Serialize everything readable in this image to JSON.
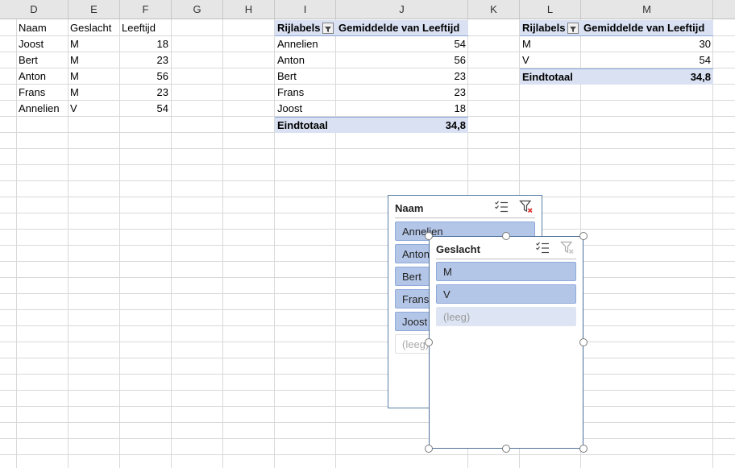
{
  "columns": [
    "D",
    "E",
    "F",
    "G",
    "H",
    "I",
    "J",
    "K",
    "L",
    "M"
  ],
  "source_table": {
    "headers": [
      "Naam",
      "Geslacht",
      "Leeftijd"
    ],
    "rows": [
      {
        "naam": "Joost",
        "geslacht": "M",
        "leeftijd": "18"
      },
      {
        "naam": "Bert",
        "geslacht": "M",
        "leeftijd": "23"
      },
      {
        "naam": "Anton",
        "geslacht": "M",
        "leeftijd": "56"
      },
      {
        "naam": "Frans",
        "geslacht": "M",
        "leeftijd": "23"
      },
      {
        "naam": "Annelien",
        "geslacht": "V",
        "leeftijd": "54"
      }
    ]
  },
  "pivot1": {
    "row_label_header": "Rijlabels",
    "value_header": "Gemiddelde van Leeftijd",
    "rows": [
      {
        "label": "Annelien",
        "value": "54"
      },
      {
        "label": "Anton",
        "value": "56"
      },
      {
        "label": "Bert",
        "value": "23"
      },
      {
        "label": "Frans",
        "value": "23"
      },
      {
        "label": "Joost",
        "value": "18"
      }
    ],
    "total_label": "Eindtotaal",
    "total_value": "34,8"
  },
  "pivot2": {
    "row_label_header": "Rijlabels",
    "value_header": "Gemiddelde van Leeftijd",
    "rows": [
      {
        "label": "M",
        "value": "30"
      },
      {
        "label": "V",
        "value": "54"
      }
    ],
    "total_label": "Eindtotaal",
    "total_value": "34,8"
  },
  "slicer_naam": {
    "title": "Naam",
    "items": [
      "Annelien",
      "Anton",
      "Bert",
      "Frans",
      "Joost",
      "(leeg)"
    ]
  },
  "slicer_geslacht": {
    "title": "Geslacht",
    "items": [
      "M",
      "V",
      "(leeg)"
    ]
  },
  "icons": {
    "multiselect": "multi-select-icon",
    "clear_filter": "clear-filter-icon"
  },
  "colors": {
    "pivot_header": "#d9e1f2",
    "slicer_item": "#b4c6e7",
    "slicer_border": "#5b7fa6"
  }
}
